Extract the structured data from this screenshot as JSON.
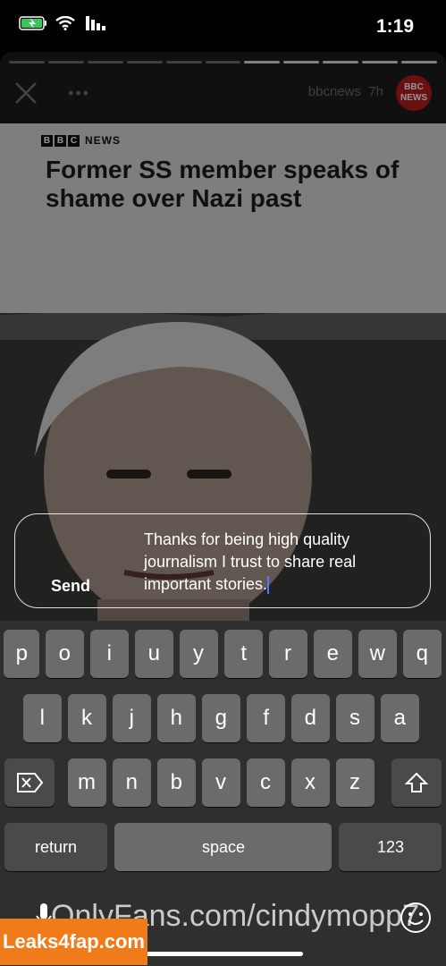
{
  "status_bar": {
    "time": "1:19"
  },
  "story": {
    "account": "bbcnews",
    "age": "7h",
    "avatar_text": "BBC\nNEWS",
    "progress_segments": 11,
    "progress_done": 5
  },
  "article": {
    "logo_letters": [
      "B",
      "B",
      "C"
    ],
    "logo_word": "NEWS",
    "headline": "Former SS member speaks of shame over Nazi past"
  },
  "reply": {
    "text": "Thanks for being high quality journalism I trust to share real important stories.",
    "send_label": "Send"
  },
  "keyboard": {
    "row1": [
      "q",
      "w",
      "e",
      "r",
      "t",
      "y",
      "u",
      "i",
      "o",
      "p"
    ],
    "row2": [
      "a",
      "s",
      "d",
      "f",
      "g",
      "h",
      "j",
      "k",
      "l"
    ],
    "row3": [
      "z",
      "x",
      "c",
      "v",
      "b",
      "n",
      "m"
    ],
    "numbers_label": "123",
    "space_label": "space",
    "return_label": "return"
  },
  "watermark": "OnlyFans.com/cindymopp7",
  "badge": "Leaks4fap.com"
}
